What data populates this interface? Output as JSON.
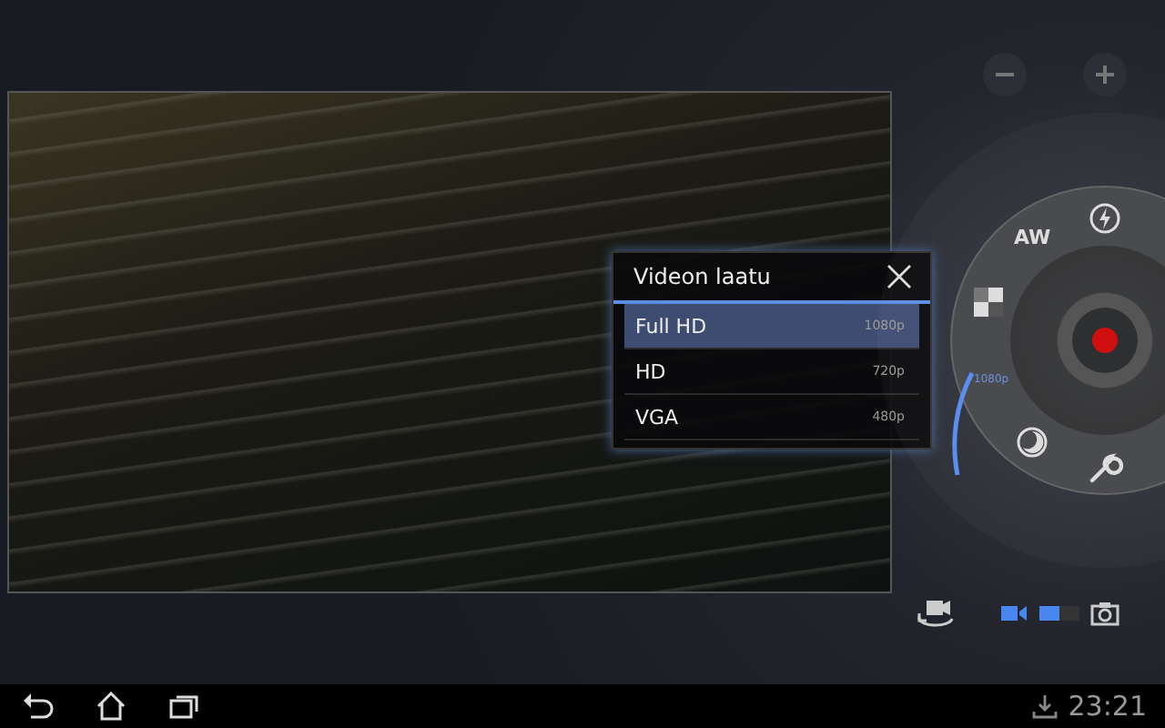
{
  "quality_menu": {
    "title": "Videon laatu",
    "options": [
      {
        "label": "Full HD",
        "resolution": "1080p",
        "selected": true
      },
      {
        "label": "HD",
        "resolution": "720p",
        "selected": false
      },
      {
        "label": "VGA",
        "resolution": "480p",
        "selected": false
      }
    ]
  },
  "dial": {
    "white_balance": "AW",
    "quality_reading": "1080p"
  },
  "mode_switch": [
    {
      "kind": "video",
      "selected": true
    },
    {
      "kind": "photo",
      "selected": false
    }
  ],
  "status_bar": {
    "clock": "23:21"
  }
}
